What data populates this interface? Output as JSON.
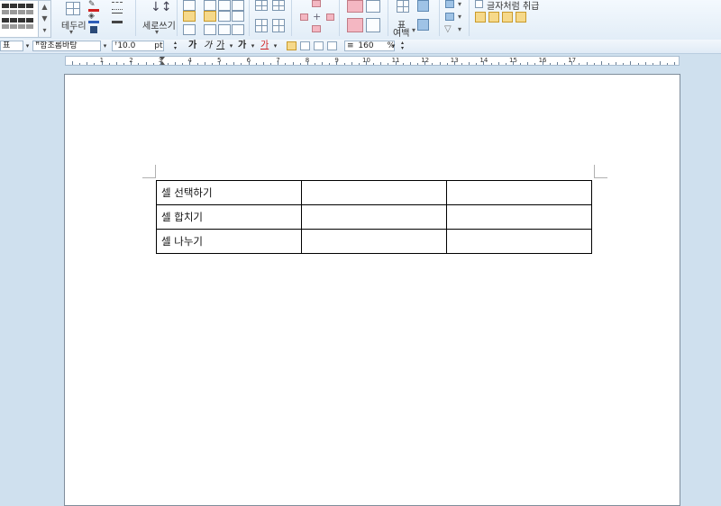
{
  "ribbon": {
    "border_label": "테두리",
    "vertical_writing_label": "세로쓰기",
    "table_label": "표",
    "margin_label": "여백",
    "treat_as_char_label": "글자처럼 취급"
  },
  "format_bar": {
    "style_value": "표",
    "font_value": "함초롬바탕",
    "font_size_value": "10.0",
    "font_size_unit": "pt",
    "bold_label": "가",
    "italic_label": "가",
    "underline_label": "가",
    "strike_label": "가",
    "color_label": "가",
    "line_spacing_value": "160",
    "line_spacing_unit": "%"
  },
  "ruler": {
    "numbers": [
      "1",
      "2",
      "3",
      "4",
      "5",
      "6",
      "7",
      "8",
      "9",
      "10",
      "11",
      "12",
      "13",
      "14",
      "15",
      "16",
      "17"
    ]
  },
  "document": {
    "table": {
      "rows": [
        [
          "셀 선택하기",
          "",
          ""
        ],
        [
          "셀 합치기",
          "",
          ""
        ],
        [
          "셀 나누기",
          "",
          ""
        ]
      ]
    }
  }
}
